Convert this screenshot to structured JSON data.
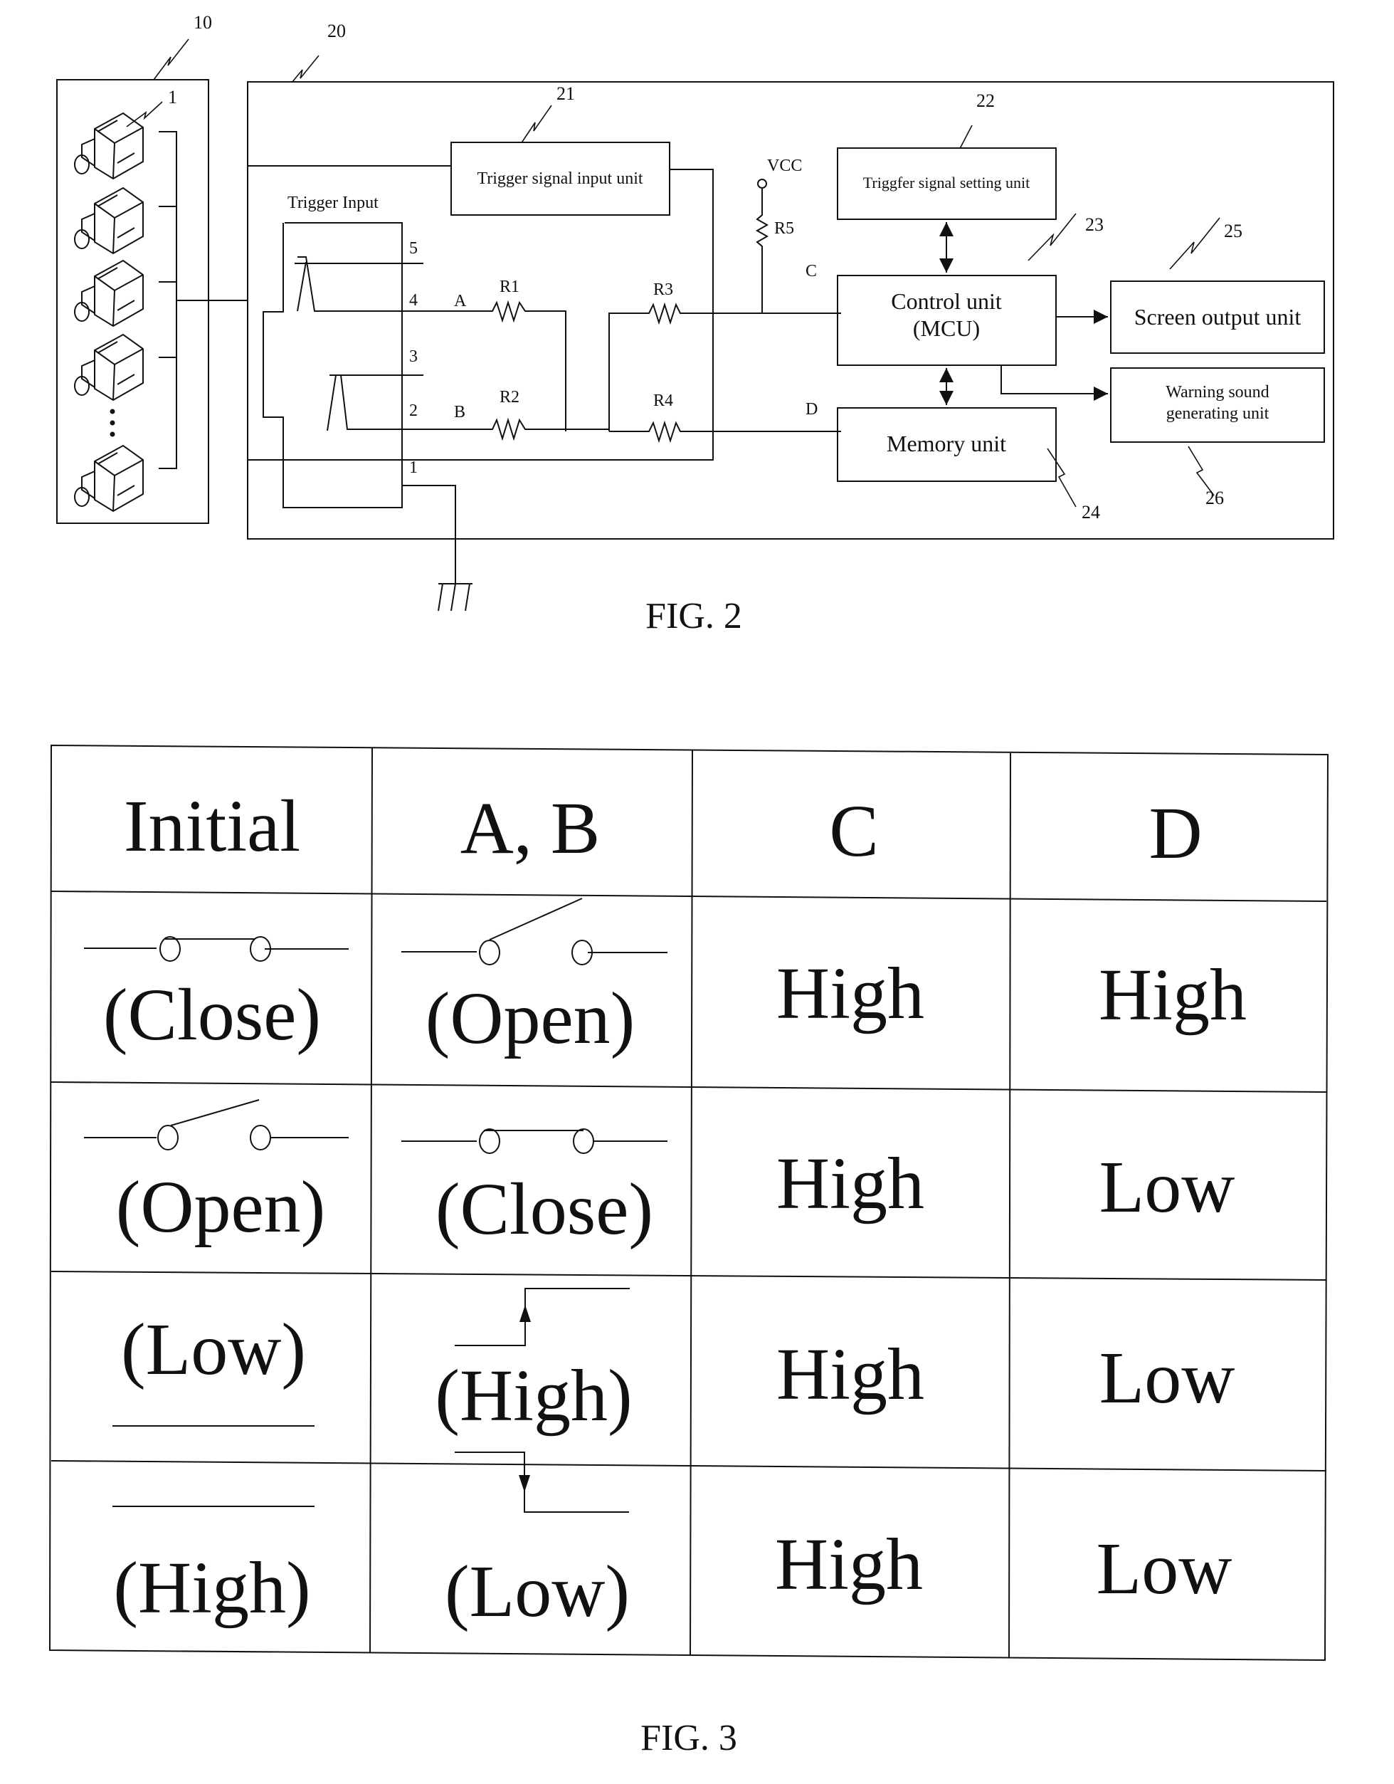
{
  "fig2": {
    "caption": "FIG. 2",
    "refs": {
      "r10": "10",
      "r20": "20",
      "r1": "1",
      "r21": "21",
      "r22": "22",
      "r23": "23",
      "r24": "24",
      "r25": "25",
      "r26": "26"
    },
    "trigger_input_label": "Trigger Input",
    "pins": [
      "5",
      "4",
      "3",
      "2",
      "1"
    ],
    "signals": {
      "a": "A",
      "b": "B",
      "c": "C",
      "d": "D"
    },
    "resistors": {
      "r1": "R1",
      "r2": "R2",
      "r3": "R3",
      "r4": "R4",
      "r5": "R5"
    },
    "vcc": "VCC",
    "units": {
      "trigger_input": "Trigger signal input unit",
      "trigger_setting": "Triggfer signal setting unit",
      "control_line1": "Control unit",
      "control_line2": "(MCU)",
      "screen_output": "Screen output unit",
      "warning_line1": "Warning sound",
      "warning_line2": "generating unit",
      "memory": "Memory unit"
    },
    "camera_count_shown": 5
  },
  "fig3": {
    "caption": "FIG. 3",
    "headers": [
      "Initial",
      "A, B",
      "C",
      "D"
    ],
    "rows": [
      {
        "initial": "(Close)",
        "initial_symbol": "switch-closed",
        "ab": "(Open)",
        "ab_symbol": "switch-open",
        "c": "High",
        "d": "High"
      },
      {
        "initial": "(Open)",
        "initial_symbol": "switch-open",
        "ab": "(Close)",
        "ab_symbol": "switch-closed",
        "c": "High",
        "d": "Low"
      },
      {
        "initial": "(Low)",
        "initial_symbol": "level-low",
        "ab": "(High)",
        "ab_symbol": "rising-edge",
        "c": "High",
        "d": "Low"
      },
      {
        "initial": "(High)",
        "initial_symbol": "level-high",
        "ab": "(Low)",
        "ab_symbol": "falling-edge",
        "c": "High",
        "d": "Low"
      }
    ]
  }
}
